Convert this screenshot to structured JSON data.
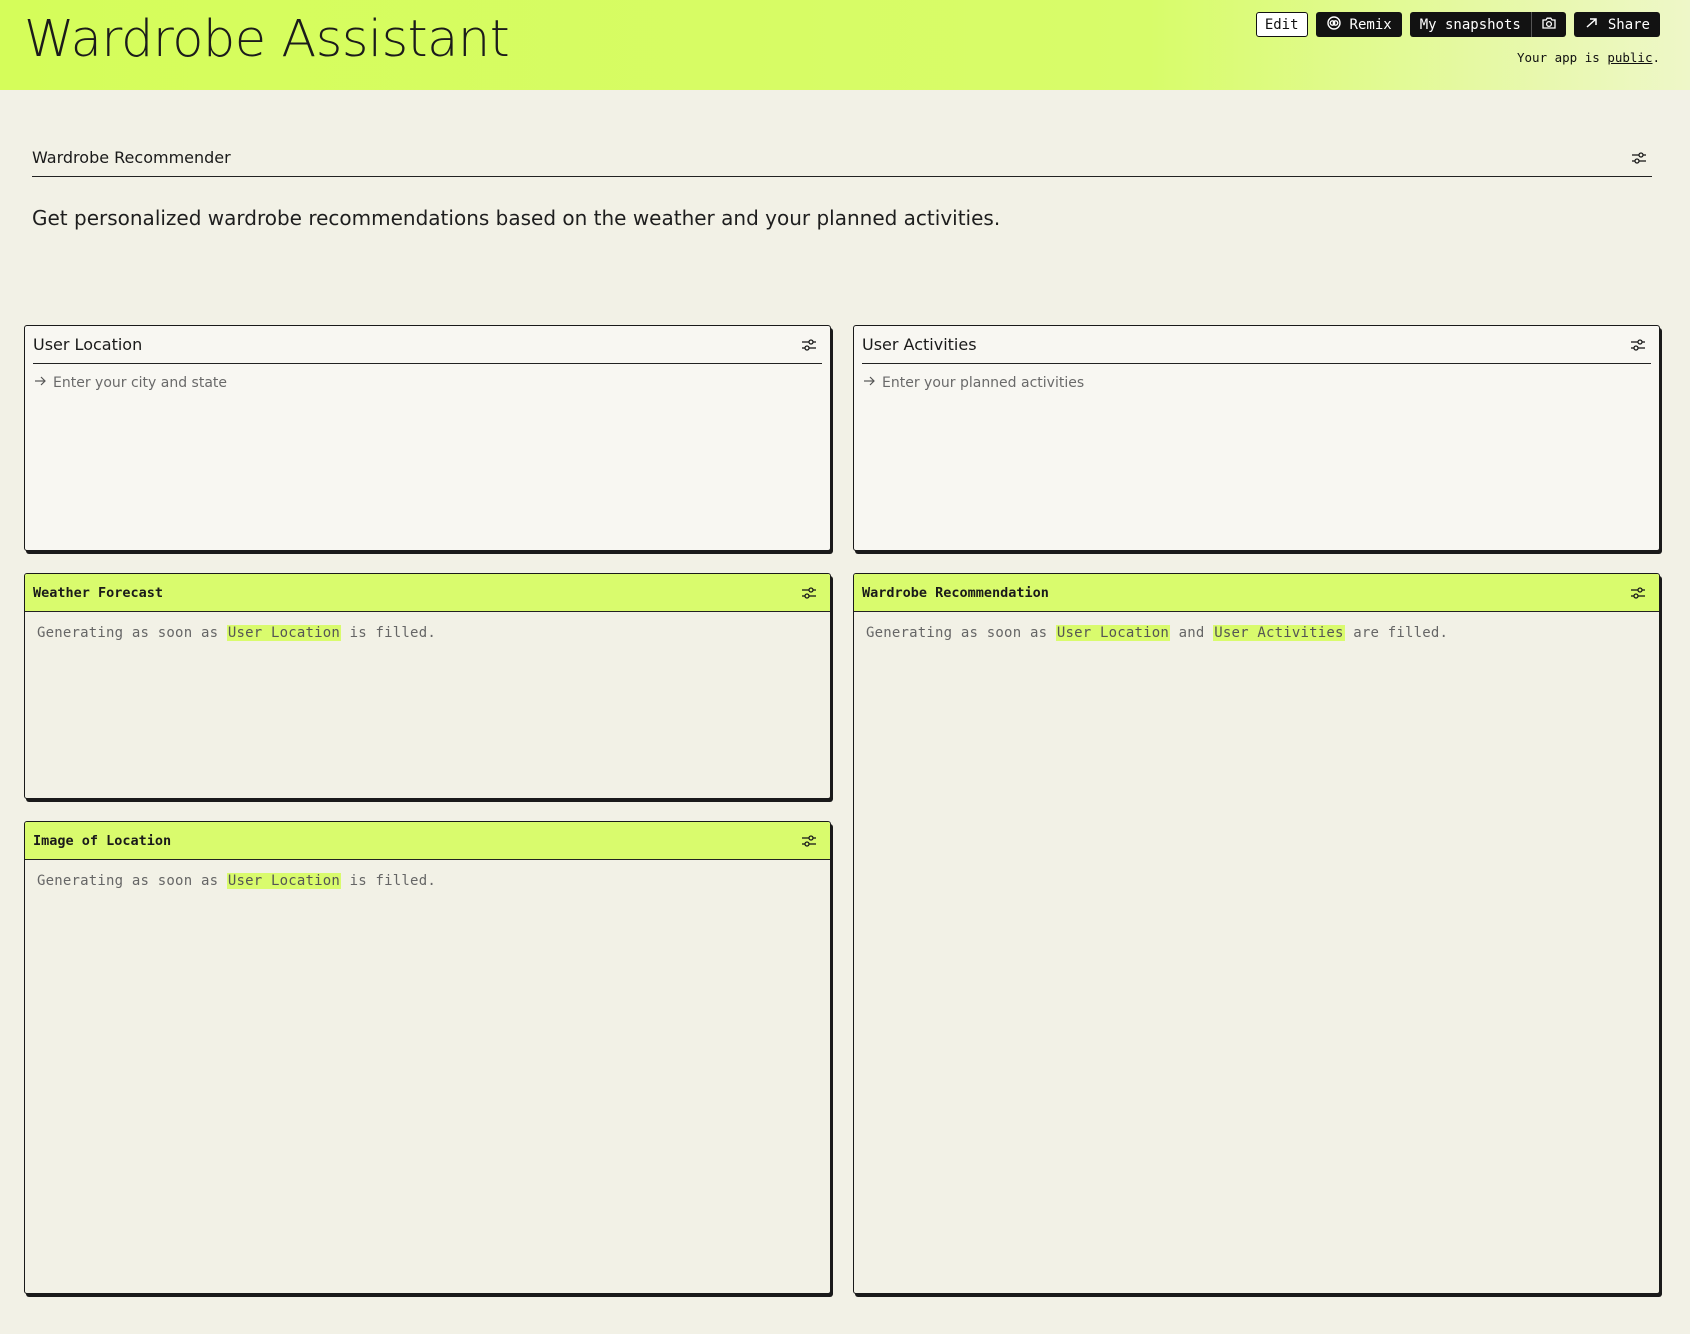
{
  "header": {
    "title": "Wardrobe Assistant",
    "toolbar": {
      "edit_label": "Edit",
      "remix_label": "Remix",
      "snapshots_label": "My snapshots",
      "share_label": "Share"
    },
    "visibility": {
      "prefix": "Your app is ",
      "link": "public",
      "suffix": "."
    }
  },
  "section": {
    "title": "Wardrobe Recommender",
    "description": "Get personalized wardrobe recommendations based on the weather and your planned activities."
  },
  "inputs": {
    "location": {
      "title": "User Location",
      "placeholder": "Enter your city and state"
    },
    "activities": {
      "title": "User Activities",
      "placeholder": "Enter your planned activities"
    }
  },
  "outputs": {
    "weather": {
      "title": "Weather Forecast",
      "prefix": "Generating as soon as ",
      "dep1": "User Location",
      "suffix": " is filled."
    },
    "recommendation": {
      "title": "Wardrobe Recommendation",
      "prefix": "Generating as soon as ",
      "dep1": "User Location",
      "joiner": " and ",
      "dep2": "User Activities",
      "suffix": " are filled."
    },
    "image": {
      "title": "Image of Location",
      "prefix": "Generating as soon as ",
      "dep1": "User Location",
      "suffix": " is filled."
    }
  },
  "colors": {
    "accent": "#d9fb6d",
    "background": "#f2f1e6",
    "ink": "#1a1a1a"
  }
}
